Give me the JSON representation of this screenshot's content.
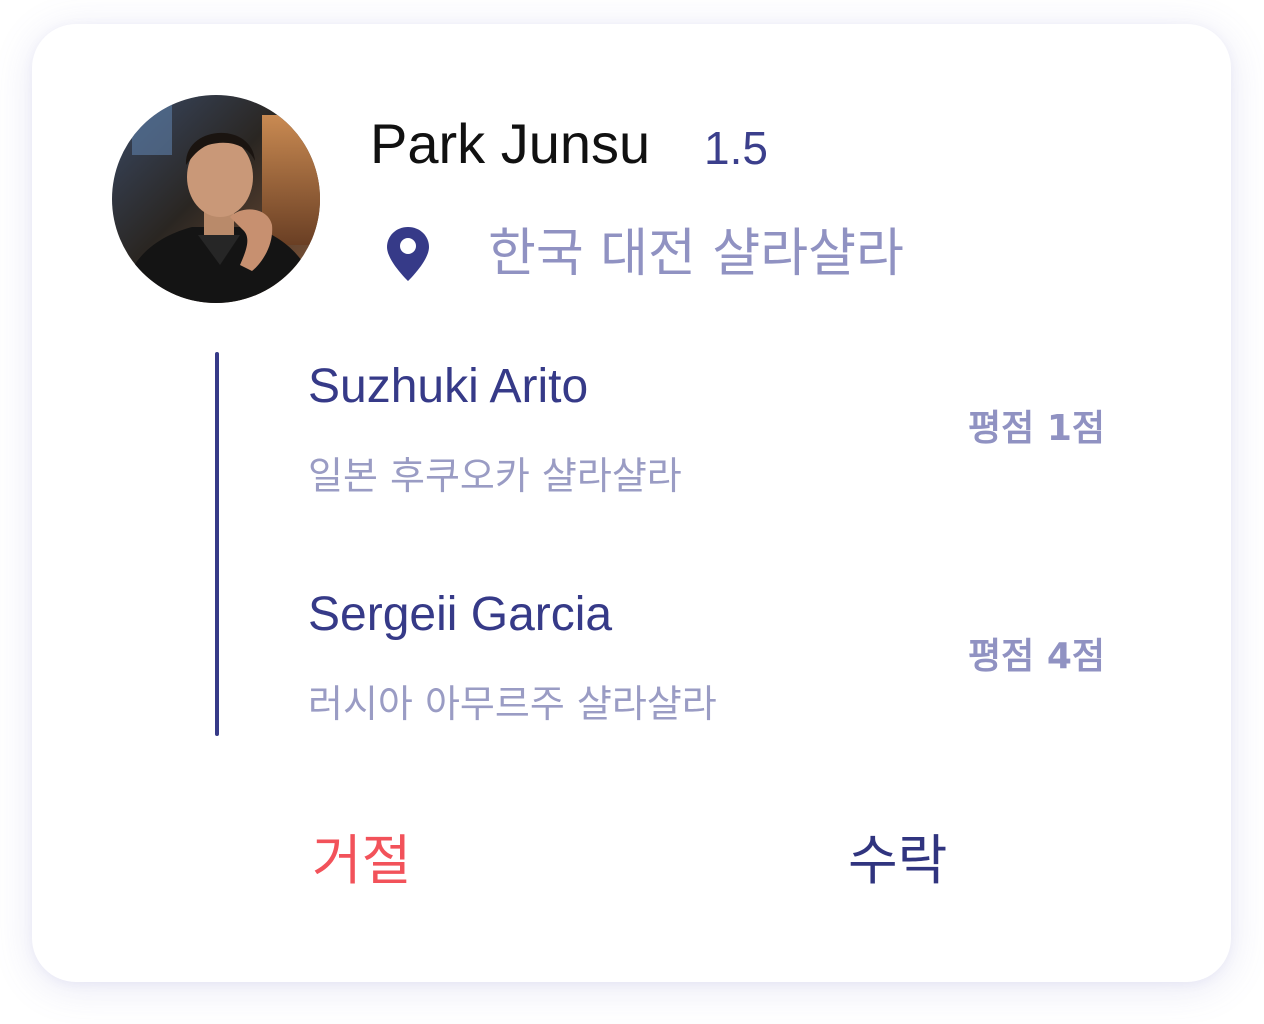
{
  "profile": {
    "name": "Park Junsu",
    "rating": "1.5",
    "location": "한국 대전 샬라샬라",
    "avatar_icon": "user-photo"
  },
  "history": [
    {
      "name": "Suzhuki Arito",
      "location": "일본 후쿠오카 샬라샬라",
      "score": "평점 1점"
    },
    {
      "name": "Sergeii Garcia",
      "location": "러시아 아무르주 샬라샬라",
      "score": "평점 4점"
    }
  ],
  "actions": {
    "reject_label": "거절",
    "accept_label": "수락"
  },
  "colors": {
    "accent": "#363a88",
    "muted": "#9092c2",
    "reject": "#f2525a"
  }
}
